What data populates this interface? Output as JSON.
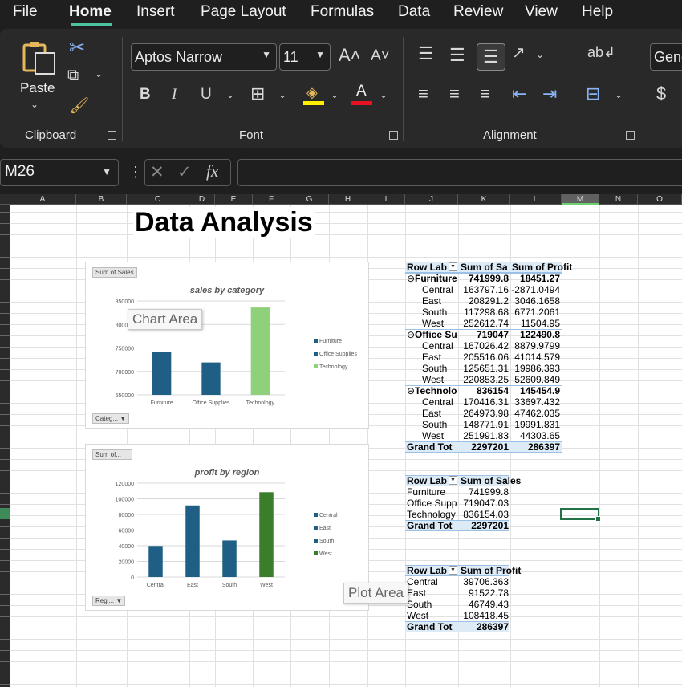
{
  "menu": {
    "file": "File",
    "home": "Home",
    "insert": "Insert",
    "page_layout": "Page Layout",
    "formulas": "Formulas",
    "data": "Data",
    "review": "Review",
    "view": "View",
    "help": "Help"
  },
  "ribbon": {
    "clipboard": {
      "paste": "Paste",
      "label": "Clipboard"
    },
    "font": {
      "family": "Aptos Narrow",
      "size": "11",
      "label": "Font",
      "bold": "B",
      "italic": "I",
      "underline": "U"
    },
    "alignment": {
      "label": "Alignment"
    },
    "number": {
      "format": "Gene",
      "currency": "$"
    }
  },
  "formula_bar": {
    "name_box": "M26",
    "fx": "fx",
    "formula": ""
  },
  "columns": [
    "A",
    "B",
    "C",
    "D",
    "E",
    "F",
    "G",
    "H",
    "I",
    "J",
    "K",
    "L",
    "M",
    "N",
    "O"
  ],
  "sheet": {
    "title": "Data Analysis"
  },
  "chart1": {
    "field_button": "Sum of Sales",
    "axis_button": "Categ...",
    "tooltip": "Chart Area",
    "chart_data": {
      "type": "bar",
      "title": "sales by category",
      "categories": [
        "Furniture",
        "Office Supplies",
        "Technology"
      ],
      "values": [
        741999.8,
        719047.03,
        836154.03
      ],
      "ylim": [
        650000,
        850000
      ],
      "yticks": [
        "650000",
        "700000",
        "750000",
        "800000",
        "850000"
      ],
      "legend": [
        "Furniture",
        "Office Supplies",
        "Technology"
      ],
      "legend_position": "right",
      "colors": [
        "#1f5f85",
        "#1f5f85",
        "#8fd17a"
      ]
    }
  },
  "chart2": {
    "field_button": "Sum of...",
    "axis_button": "Regi...",
    "tooltip": "Plot Area",
    "chart_data": {
      "type": "bar",
      "title": "profit by region",
      "categories": [
        "Central",
        "East",
        "South",
        "West"
      ],
      "values": [
        39706.363,
        91522.78,
        46749.43,
        108418.45
      ],
      "ylim": [
        0,
        120000
      ],
      "yticks": [
        "0",
        "20000",
        "40000",
        "60000",
        "80000",
        "100000",
        "120000"
      ],
      "legend": [
        "Central",
        "East",
        "South",
        "West"
      ],
      "legend_position": "right",
      "colors": [
        "#1f5f85",
        "#1f5f85",
        "#1f5f85",
        "#3a7d2a"
      ]
    }
  },
  "pivot1": {
    "headers": [
      "Row Lab",
      "Sum of Sa",
      "Sum of Profit"
    ],
    "groups": [
      {
        "name": "Furniture",
        "sales": "741999.8",
        "profit": "18451.27",
        "rows": [
          [
            "Central",
            "163797.16",
            "-2871.0494"
          ],
          [
            "East",
            "208291.2",
            "3046.1658"
          ],
          [
            "South",
            "117298.68",
            "6771.2061"
          ],
          [
            "West",
            "252612.74",
            "11504.95"
          ]
        ]
      },
      {
        "name": "Office Su",
        "sales": "719047",
        "profit": "122490.8",
        "rows": [
          [
            "Central",
            "167026.42",
            "8879.9799"
          ],
          [
            "East",
            "205516.06",
            "41014.579"
          ],
          [
            "South",
            "125651.31",
            "19986.393"
          ],
          [
            "West",
            "220853.25",
            "52609.849"
          ]
        ]
      },
      {
        "name": "Technolo",
        "sales": "836154",
        "profit": "145454.9",
        "rows": [
          [
            "Central",
            "170416.31",
            "33697.432"
          ],
          [
            "East",
            "264973.98",
            "47462.035"
          ],
          [
            "South",
            "148771.91",
            "19991.831"
          ],
          [
            "West",
            "251991.83",
            "44303.65"
          ]
        ]
      }
    ],
    "grand": [
      "Grand Tot",
      "2297201",
      "286397"
    ]
  },
  "pivot2": {
    "headers": [
      "Row Lab",
      "Sum of Sales"
    ],
    "rows": [
      [
        "Furniture",
        "741999.8"
      ],
      [
        "Office Supp",
        "719047.03"
      ],
      [
        "Technology",
        "836154.03"
      ]
    ],
    "grand": [
      "Grand Tot",
      "2297201"
    ]
  },
  "pivot3": {
    "headers": [
      "Row Lab",
      "Sum of Profit"
    ],
    "rows": [
      [
        "Central",
        "39706.363"
      ],
      [
        "East",
        "91522.78"
      ],
      [
        "South",
        "46749.43"
      ],
      [
        "West",
        "108418.45"
      ]
    ],
    "grand": [
      "Grand Tot",
      "286397"
    ]
  }
}
